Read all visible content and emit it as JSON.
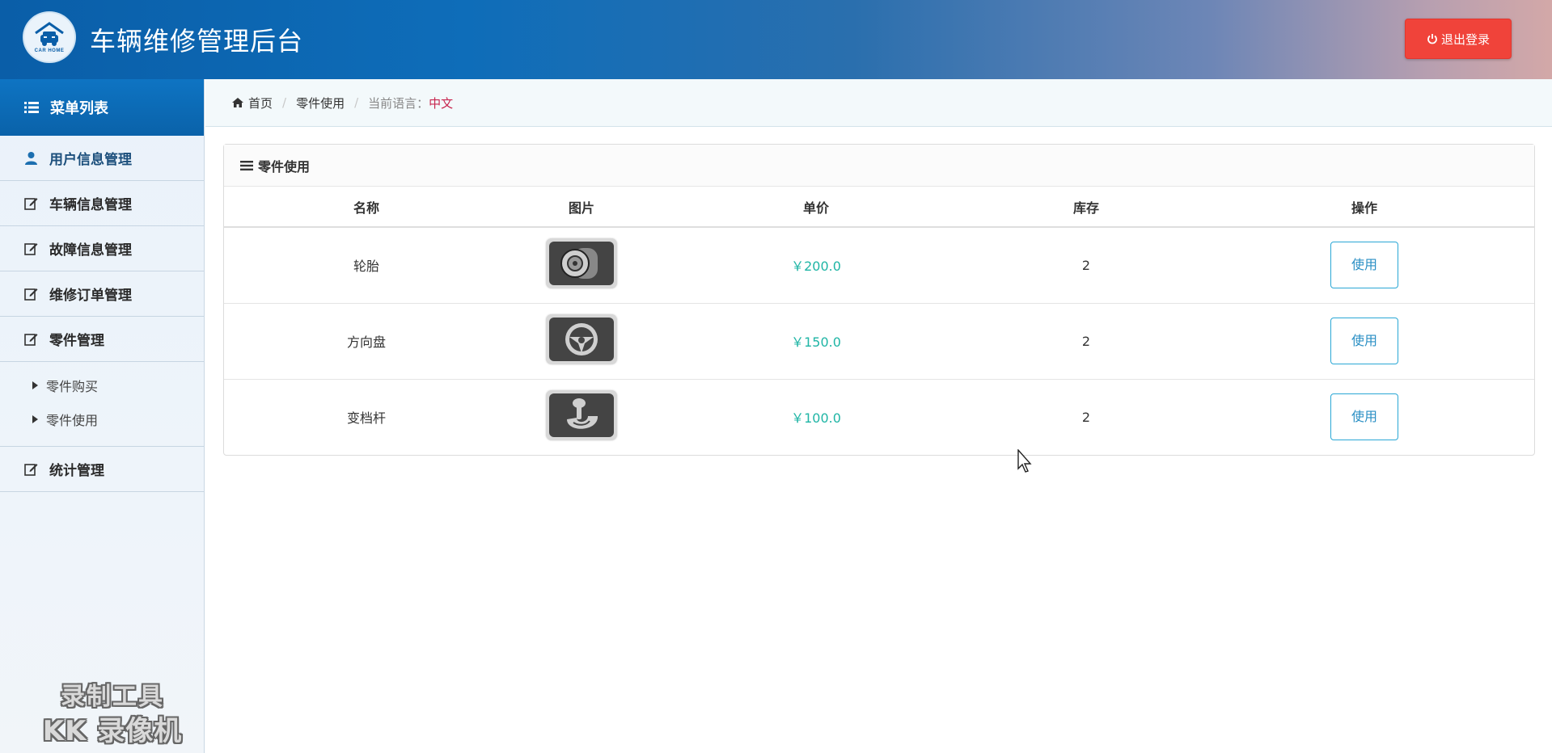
{
  "header": {
    "logo_text": "CAR HOME",
    "title": "车辆维修管理后台",
    "logout_label": "退出登录"
  },
  "sidebar": {
    "menu_title": "菜单列表",
    "items": [
      {
        "label": "用户信息管理",
        "icon": "user-icon"
      },
      {
        "label": "车辆信息管理",
        "icon": "edit-icon"
      },
      {
        "label": "故障信息管理",
        "icon": "edit-icon"
      },
      {
        "label": "维修订单管理",
        "icon": "edit-icon"
      },
      {
        "label": "零件管理",
        "icon": "edit-icon"
      },
      {
        "label": "统计管理",
        "icon": "edit-icon"
      }
    ],
    "submenu": [
      {
        "label": "零件购买"
      },
      {
        "label": "零件使用"
      }
    ]
  },
  "breadcrumb": {
    "home": "首页",
    "current": "零件使用",
    "lang_prefix": "当前语言：",
    "lang": "中文"
  },
  "panel": {
    "title": "零件使用",
    "columns": [
      "名称",
      "图片",
      "单价",
      "库存",
      "操作"
    ],
    "rows": [
      {
        "name": "轮胎",
        "image": "tire-image",
        "price": "￥200.0",
        "stock": "2",
        "action": "使用"
      },
      {
        "name": "方向盘",
        "image": "steering-wheel-image",
        "price": "￥150.0",
        "stock": "2",
        "action": "使用"
      },
      {
        "name": "变档杆",
        "image": "gear-shift-image",
        "price": "￥100.0",
        "stock": "2",
        "action": "使用"
      }
    ]
  },
  "watermark": {
    "line1": "录制工具",
    "line2": "KK 录像机"
  },
  "colors": {
    "header_blue": "#0a5ea8",
    "logout_red": "#f0433a",
    "price_teal": "#1fb5a5",
    "button_border": "#2aa7d5"
  }
}
